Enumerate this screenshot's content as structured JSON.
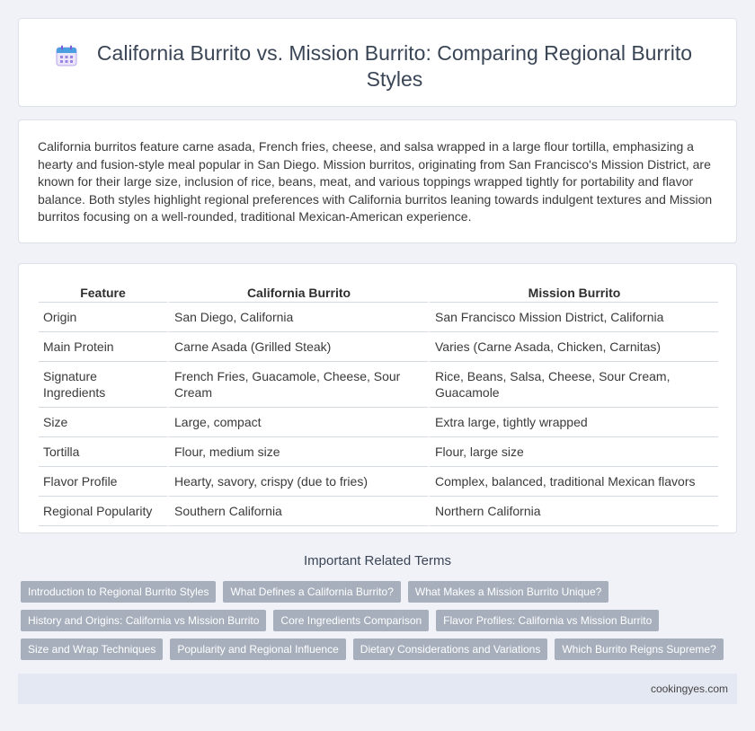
{
  "header": {
    "title": "California Burrito vs. Mission Burrito: Comparing Regional Burrito Styles",
    "icon": "calendar-icon"
  },
  "intro": {
    "text": "California burritos feature carne asada, French fries, cheese, and salsa wrapped in a large flour tortilla, emphasizing a hearty and fusion-style meal popular in San Diego. Mission burritos, originating from San Francisco's Mission District, are known for their large size, inclusion of rice, beans, meat, and various toppings wrapped tightly for portability and flavor balance. Both styles highlight regional preferences with California burritos leaning towards indulgent textures and Mission burritos focusing on a well-rounded, traditional Mexican-American experience."
  },
  "table": {
    "headers": [
      "Feature",
      "California Burrito",
      "Mission Burrito"
    ],
    "rows": [
      [
        "Origin",
        "San Diego, California",
        "San Francisco Mission District, California"
      ],
      [
        "Main Protein",
        "Carne Asada (Grilled Steak)",
        "Varies (Carne Asada, Chicken, Carnitas)"
      ],
      [
        "Signature Ingredients",
        "French Fries, Guacamole, Cheese, Sour Cream",
        "Rice, Beans, Salsa, Cheese, Sour Cream, Guacamole"
      ],
      [
        "Size",
        "Large, compact",
        "Extra large, tightly wrapped"
      ],
      [
        "Tortilla",
        "Flour, medium size",
        "Flour, large size"
      ],
      [
        "Flavor Profile",
        "Hearty, savory, crispy (due to fries)",
        "Complex, balanced, traditional Mexican flavors"
      ],
      [
        "Regional Popularity",
        "Southern California",
        "Northern California"
      ]
    ]
  },
  "related": {
    "title": "Important Related Terms",
    "tags": [
      [
        "Introduction to Regional Burrito Styles",
        "What Defines a California Burrito?",
        "What Makes a Mission Burrito Unique?"
      ],
      [
        "History and Origins: California vs Mission Burrito",
        "Core Ingredients Comparison",
        "Flavor Profiles: California vs Mission Burrito"
      ],
      [
        "Size and Wrap Techniques",
        "Popularity and Regional Influence",
        "Dietary Considerations and Variations",
        "Which Burrito Reigns Supreme?"
      ]
    ]
  },
  "footer": {
    "site": "cookingyes.com"
  },
  "colors": {
    "background": "#f0f2f7",
    "tag": "#a7afbd",
    "footer": "#e4e8f2",
    "icon_accent": "#7b5cd6",
    "icon_header": "#4a9fe0"
  }
}
